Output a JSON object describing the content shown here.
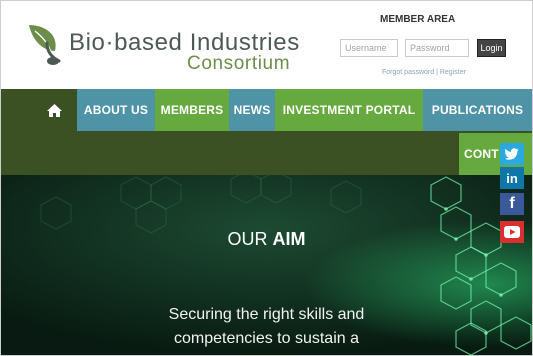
{
  "header": {
    "logo_line1": "Bio·based Industries",
    "logo_line2": "Consortium",
    "member_area": "MEMBER AREA",
    "username_placeholder": "Username",
    "password_placeholder": "Password",
    "login_label": "Login",
    "forgot_label": "Forgot password",
    "separator": " | ",
    "register_label": "Register"
  },
  "nav": {
    "home_icon": "home-icon",
    "items": [
      "ABOUT US",
      "MEMBERS",
      "NEWS",
      "INVESTMENT PORTAL",
      "PUBLICATIONS",
      "CONT"
    ]
  },
  "hero": {
    "aim_prefix": "OUR ",
    "aim_strong": "AIM",
    "tagline_line1": "Securing the right skills and",
    "tagline_line2": "competencies to sustain a"
  },
  "social": {
    "twitter": "twitter-icon",
    "linkedin": "in",
    "facebook": "f",
    "youtube": "youtube-icon"
  },
  "colors": {
    "nav_dark": "#3b5124",
    "nav_blue": "#4f93a7",
    "nav_green": "#66a93f",
    "hero_bg": "#0b2117",
    "logo_text": "#4d5a54",
    "logo_green": "#6c8e4b"
  }
}
